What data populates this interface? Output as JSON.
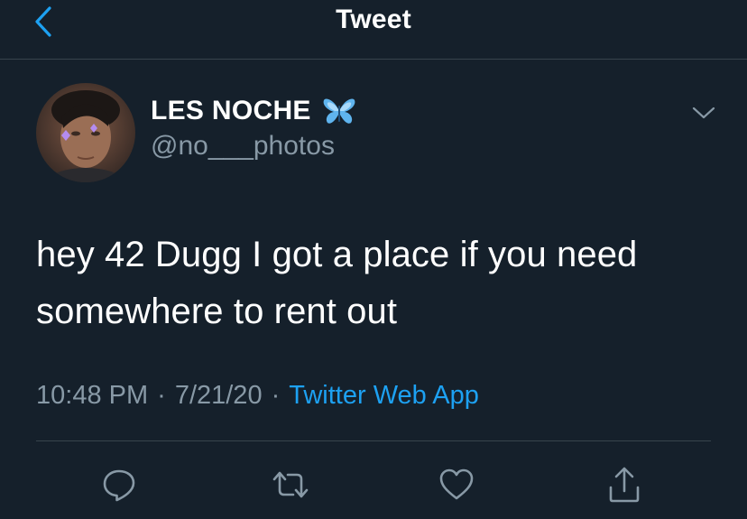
{
  "header": {
    "title": "Tweet"
  },
  "tweet": {
    "display_name": "LES NOCHE",
    "handle": "@no___photos",
    "text": "hey 42 Dugg I got a place if you need somewhere to rent out",
    "time": "10:48 PM",
    "date": "7/21/20",
    "source": "Twitter Web App",
    "separator": "·"
  },
  "icons": {
    "back": "chevron-left-icon",
    "caret": "chevron-down-icon",
    "badge": "butterfly-emoji",
    "reply": "reply-icon",
    "retweet": "retweet-icon",
    "like": "heart-icon",
    "share": "share-icon"
  },
  "colors": {
    "background": "#15202b",
    "accent": "#1da1f2",
    "secondary_text": "#8899a6",
    "divider": "#38444d"
  }
}
